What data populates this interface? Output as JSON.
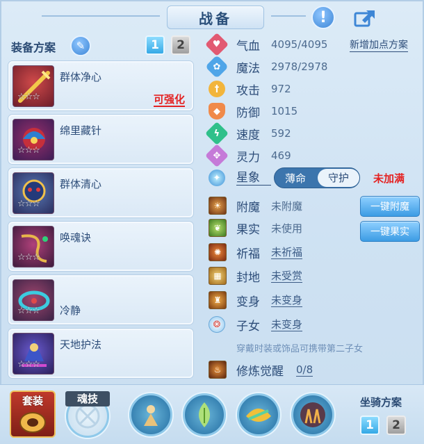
{
  "header": {
    "title": "战备"
  },
  "equip": {
    "label": "装备方案",
    "plan_tabs": [
      "1",
      "2"
    ],
    "cards": [
      {
        "name": "群体净心",
        "stars": "☆☆☆",
        "tag": "可强化"
      },
      {
        "name": "绵里藏针",
        "stars": "☆☆☆",
        "tag": ""
      },
      {
        "name": "群体清心",
        "stars": "☆☆☆",
        "tag": ""
      },
      {
        "name": "唤魂诀",
        "stars": "☆☆☆",
        "tag": ""
      },
      {
        "name": "冷静",
        "stars": "☆☆☆",
        "tag": ""
      },
      {
        "name": "天地护法",
        "stars": "☆☆☆",
        "tag": ""
      }
    ]
  },
  "stats": {
    "hp_label": "气血",
    "hp_value": "4095/4095",
    "mp_label": "魔法",
    "mp_value": "2978/2978",
    "atk_label": "攻击",
    "atk_value": "972",
    "def_label": "防御",
    "def_value": "1015",
    "spd_label": "速度",
    "spd_value": "592",
    "spi_label": "灵力",
    "spi_value": "469",
    "add_plan_link": "新增加点方案"
  },
  "star": {
    "label": "星象",
    "options": [
      "薄命",
      "守护"
    ],
    "selected": "守护",
    "status": "未加满"
  },
  "extras": {
    "enchant_label": "附魔",
    "enchant_value": "未附魔",
    "fruit_label": "果实",
    "fruit_value": "未使用",
    "bless_label": "祈福",
    "bless_value": "未祈福",
    "fief_label": "封地",
    "fief_value": "未受赏",
    "transform_label": "变身",
    "transform_value": "未变身",
    "child_label": "子女",
    "child_value": "未变身",
    "note": "穿戴时装或饰品可携带第二子女",
    "cultivate_label": "修炼觉醒",
    "cultivate_value": "0/8",
    "btn_enchant": "一键附魔",
    "btn_fruit": "一键果实"
  },
  "bottom": {
    "suit_label": "套装",
    "soul_label": "魂技",
    "mount_label": "坐骑方案",
    "mount_tabs": [
      "1",
      "2"
    ]
  },
  "colors": {
    "accent_red": "#e42222",
    "accent_blue": "#34a9e6",
    "text": "#2d4d79"
  }
}
